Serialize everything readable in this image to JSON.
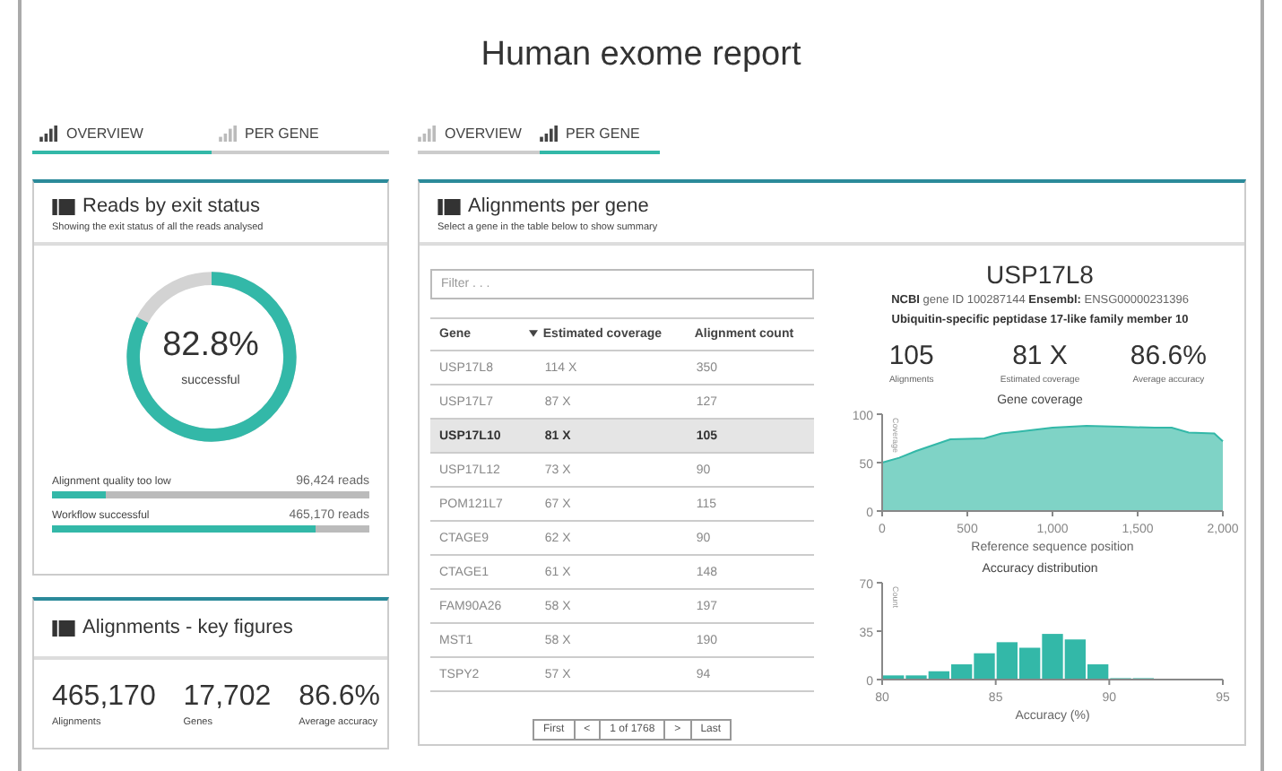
{
  "title": "Human exome report",
  "left_tabs": [
    {
      "label": "OVERVIEW",
      "selected": true
    },
    {
      "label": "PER GENE",
      "selected": false
    }
  ],
  "right_tabs": [
    {
      "label": "OVERVIEW",
      "selected": false
    },
    {
      "label": "PER GENE",
      "selected": true
    }
  ],
  "reads_panel": {
    "title": "Reads by exit status",
    "subtitle": "Showing the exit status of all the reads analysed",
    "donut": {
      "value": "82.8%",
      "label": "successful"
    },
    "bars": [
      {
        "label": "Alignment quality too low",
        "reading": "96,424 reads",
        "level": 0.17
      },
      {
        "label": "Workflow successful",
        "reading": "465,170 reads",
        "level": 0.83
      }
    ]
  },
  "key_figures": {
    "title": "Alignments - key figures",
    "figures": [
      {
        "value": "465,170",
        "label": "Alignments"
      },
      {
        "value": "17,702",
        "label": "Genes"
      },
      {
        "value": "86.6%",
        "label": "Average accuracy"
      }
    ]
  },
  "genes_panel": {
    "title": "Alignments per gene",
    "subtitle": "Select a gene in the table below to show summary",
    "filter": {
      "placeholder": "Filter . . ."
    },
    "table": {
      "columns": [
        {
          "label": "Gene",
          "sorted": false
        },
        {
          "label": "Estimated coverage",
          "sorted": true
        },
        {
          "label": "Alignment count",
          "sorted": false
        }
      ],
      "rows": [
        {
          "cells": [
            "USP17L8",
            "114 X",
            "350"
          ],
          "selected": false
        },
        {
          "cells": [
            "USP17L7",
            "87 X",
            "127"
          ],
          "selected": false
        },
        {
          "cells": [
            "USP17L10",
            "81 X",
            "105"
          ],
          "selected": true
        },
        {
          "cells": [
            "USP17L12",
            "73 X",
            "90"
          ],
          "selected": false
        },
        {
          "cells": [
            "POM121L7",
            "67 X",
            "115"
          ],
          "selected": false
        },
        {
          "cells": [
            "CTAGE9",
            "62 X",
            "90"
          ],
          "selected": false
        },
        {
          "cells": [
            "CTAGE1",
            "61 X",
            "148"
          ],
          "selected": false
        },
        {
          "cells": [
            "FAM90A26",
            "58 X",
            "197"
          ],
          "selected": false
        },
        {
          "cells": [
            "MST1",
            "58 X",
            "190"
          ],
          "selected": false
        },
        {
          "cells": [
            "TSPY2",
            "57 X",
            "94"
          ],
          "selected": false
        }
      ]
    },
    "pager": [
      "First",
      "<",
      "1 of 1768",
      ">",
      "Last"
    ],
    "detail": {
      "gene": "USP17L8",
      "ids": "**NCBI** gene ID 100287144  **Ensembl:** ENSG00000231396",
      "description": "Ubiquitin-specific peptidase 17-like family member 10",
      "stats": [
        {
          "value": "105",
          "label": "Alignments"
        },
        {
          "value": "81 X",
          "label": "Estimated coverage"
        },
        {
          "value": "86.6%",
          "label": "Average accuracy"
        }
      ],
      "coverage": {
        "chart_data": {
          "type": "area",
          "title": "Gene coverage",
          "xlabel": "Reference sequence position",
          "ylabel": "Coverage",
          "x": [
            0,
            100,
            200,
            300,
            400,
            600,
            700,
            800,
            1000,
            1200,
            1400,
            1600,
            1700,
            1800,
            1950,
            2000
          ],
          "series": [
            {
              "color": "#7fd3c6",
              "values": [
                50,
                55,
                62,
                68,
                74,
                75,
                80,
                82,
                86,
                88,
                87,
                86,
                86,
                81,
                80,
                72
              ]
            }
          ],
          "xlim": [
            0,
            2000
          ],
          "ylim": [
            0,
            100
          ],
          "xticks": [
            0,
            {
              "value": 500,
              "label": "500"
            },
            {
              "value": 1000,
              "label": "1,000"
            },
            {
              "value": 1500,
              "label": "1,500"
            },
            {
              "value": 2000,
              "label": "2,000"
            }
          ],
          "yticks": [
            0,
            50,
            100
          ]
        }
      },
      "accuracy": {
        "chart_data": {
          "type": "bar",
          "title": "Accuracy distribution",
          "xlabel": "Accuracy (%)",
          "ylabel": "Count",
          "x": [
            80.5,
            81.5,
            82.5,
            83.5,
            84.5,
            85.5,
            86.5,
            87.5,
            88.5,
            89.5,
            90.5,
            91.5,
            92.5,
            93.5,
            94.5
          ],
          "series": [
            {
              "color": "#33b8a8",
              "values": [
                3,
                3,
                6,
                11,
                19,
                27,
                23,
                33,
                29,
                11,
                1,
                1,
                0,
                0,
                0
              ]
            }
          ],
          "xlim": [
            80,
            95
          ],
          "ylim": [
            0,
            70
          ],
          "xticks": [
            80,
            85,
            90,
            95
          ],
          "yticks": [
            0,
            35,
            70
          ]
        }
      }
    }
  }
}
